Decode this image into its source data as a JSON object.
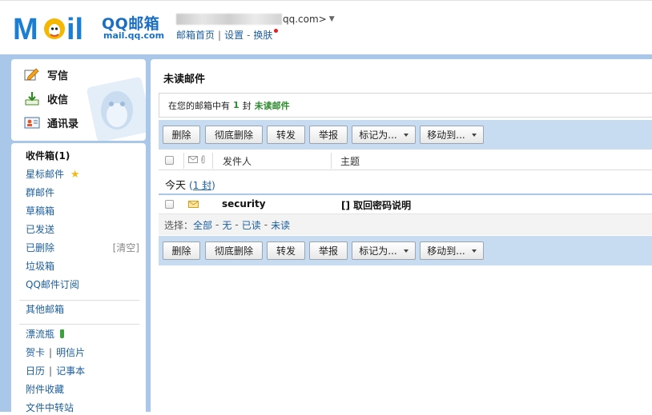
{
  "header": {
    "brand_title": "QQ邮箱",
    "brand_url": "mail.qq.com",
    "account_suffix": "qq.com>",
    "links": [
      "邮箱首页",
      "设置",
      "换肤"
    ],
    "link_separator": "|",
    "link_dash": "-"
  },
  "sidebar": {
    "actions": [
      {
        "label": "写信",
        "icon": "compose-icon"
      },
      {
        "label": "收信",
        "icon": "inbox-download-icon"
      },
      {
        "label": "通讯录",
        "icon": "contacts-icon"
      }
    ],
    "folders": {
      "inbox": "收件箱(1)",
      "starred": "星标邮件",
      "group": "群邮件",
      "drafts": "草稿箱",
      "sent": "已发送",
      "deleted": "已删除",
      "deleted_clear": "[清空]",
      "spam": "垃圾箱",
      "subscriptions": "QQ邮件订阅",
      "other": "其他邮箱",
      "drift_bottle": "漂流瓶",
      "cards": "贺卡",
      "postcards": "明信片",
      "calendar": "日历",
      "notes": "记事本",
      "attachments": "附件收藏",
      "file_transfer": "文件中转站",
      "pair_separator": "|"
    }
  },
  "main": {
    "title": "未读邮件",
    "notice": {
      "prefix": "在您的邮箱中有",
      "count": "1",
      "unit": "封",
      "suffix": "未读邮件"
    },
    "toolbar": {
      "delete": "删除",
      "delete_permanent": "彻底删除",
      "forward": "转发",
      "report": "举报",
      "mark_as": "标记为...",
      "move_to": "移动到..."
    },
    "columns": {
      "sender": "发件人",
      "subject": "主题"
    },
    "group": {
      "label": "今天",
      "count_open": "(",
      "count_link": "1 封",
      "count_close": ")"
    },
    "messages": [
      {
        "sender": "security",
        "subject": "[] 取回密码说明"
      }
    ],
    "select": {
      "label": "选择：",
      "all": "全部",
      "none": "无",
      "read": "已读",
      "unread": "未读",
      "dash": "-"
    }
  },
  "colors": {
    "accent": "#1a6fc4",
    "frame_blue": "#a9c7e8",
    "toolbar_blue": "#c7dbf1",
    "link": "#1b5e9e",
    "unread_green": "#2d8a2d"
  }
}
